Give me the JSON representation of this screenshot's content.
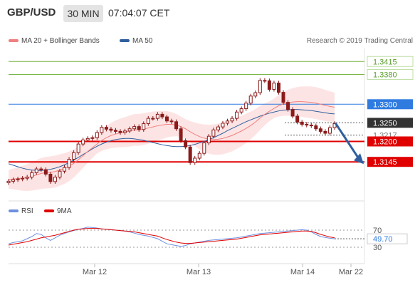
{
  "header": {
    "pair": "GBP/USD",
    "timeframe": "30 MIN",
    "time": "07:04:07 CET"
  },
  "legend": {
    "ma20_label": "MA 20 + Bollinger Bands",
    "ma50_label": "MA 50",
    "credit": "Research © 2019 Trading Central",
    "rsi_label": "RSI",
    "ma9_label": "9MA"
  },
  "colors": {
    "ma20": "#f08080",
    "ma50": "#2f5f9e",
    "bollinger_fill": "#fde4e4",
    "resistance_green": "#7ab648",
    "pivot_blue": "#2f7be0",
    "support_red": "#e00000",
    "rsi_line": "#6f8fe0",
    "rsi_ma": "#e00000",
    "candle": "#8b1a1a"
  },
  "chart_data": [
    {
      "type": "candlestick",
      "title": "GBP/USD",
      "timeframe": "30 MIN",
      "x_ticks": [
        "Mar 12",
        "Mar 13",
        "Mar 14",
        "Mar 22"
      ],
      "y_range": [
        1.304,
        1.345
      ],
      "levels": [
        {
          "value": "1.3415",
          "kind": "resistance",
          "color": "#7ab648"
        },
        {
          "value": "1.3380",
          "kind": "resistance",
          "color": "#7ab648"
        },
        {
          "value": "1.3300",
          "kind": "pivot",
          "color": "#2f7be0"
        },
        {
          "value": "1.3250",
          "kind": "last",
          "color": "#333333"
        },
        {
          "value": "1.3217",
          "kind": "reference",
          "color": "#777777"
        },
        {
          "value": "1.3200",
          "kind": "support",
          "color": "#e00000"
        },
        {
          "value": "1.3145",
          "kind": "support",
          "color": "#e00000"
        }
      ],
      "close": [
        1.3093,
        1.3097,
        1.3099,
        1.3101,
        1.3104,
        1.3116,
        1.3126,
        1.3124,
        1.3112,
        1.3092,
        1.3104,
        1.312,
        1.313,
        1.3152,
        1.317,
        1.3193,
        1.3204,
        1.3208,
        1.321,
        1.3224,
        1.3238,
        1.3233,
        1.323,
        1.3227,
        1.3224,
        1.3228,
        1.3234,
        1.324,
        1.3232,
        1.3248,
        1.3262,
        1.3262,
        1.3273,
        1.3266,
        1.3255,
        1.3253,
        1.3234,
        1.3202,
        1.3185,
        1.3143,
        1.3155,
        1.3168,
        1.3196,
        1.3214,
        1.3231,
        1.3239,
        1.3249,
        1.3255,
        1.3262,
        1.3279,
        1.3288,
        1.3303,
        1.3322,
        1.3331,
        1.3364,
        1.3363,
        1.334,
        1.3357,
        1.3332,
        1.3305,
        1.3286,
        1.3268,
        1.3252,
        1.3246,
        1.3244,
        1.3242,
        1.3234,
        1.3227,
        1.3222,
        1.3237,
        1.3248
      ],
      "ma20": [
        1.3098,
        1.3099,
        1.31,
        1.3101,
        1.3103,
        1.3106,
        1.311,
        1.3114,
        1.3116,
        1.3117,
        1.3119,
        1.3123,
        1.3127,
        1.3133,
        1.3141,
        1.3151,
        1.3162,
        1.3173,
        1.3183,
        1.3193,
        1.3203,
        1.321,
        1.3216,
        1.322,
        1.3223,
        1.3225,
        1.3228,
        1.3231,
        1.3231,
        1.3233,
        1.3236,
        1.3239,
        1.3242,
        1.3244,
        1.3246,
        1.3246,
        1.3244,
        1.324,
        1.3234,
        1.3226,
        1.3219,
        1.3213,
        1.3209,
        1.3206,
        1.3205,
        1.3206,
        1.3208,
        1.3212,
        1.3216,
        1.3222,
        1.3228,
        1.3235,
        1.3243,
        1.3252,
        1.3263,
        1.3273,
        1.3281,
        1.3289,
        1.3296,
        1.3301,
        1.3304,
        1.3306,
        1.3307,
        1.3307,
        1.3306,
        1.3305,
        1.3303,
        1.33,
        1.3297,
        1.3294,
        1.3292
      ],
      "ma50": [
        1.314,
        1.3136,
        1.3132,
        1.3128,
        1.3125,
        1.3123,
        1.3122,
        1.3122,
        1.3123,
        1.3125,
        1.3128,
        1.3132,
        1.3137,
        1.3143,
        1.315,
        1.3157,
        1.3165,
        1.3172,
        1.318,
        1.3187,
        1.3193,
        1.3198,
        1.3202,
        1.3205,
        1.3207,
        1.3208,
        1.3208,
        1.3207,
        1.3205,
        1.3203,
        1.32,
        1.3197,
        1.3194,
        1.3191,
        1.3189,
        1.3187,
        1.3186,
        1.3186,
        1.3187,
        1.3189,
        1.3192,
        1.3196,
        1.32,
        1.3205,
        1.321,
        1.3216,
        1.3222,
        1.3229,
        1.3235,
        1.3241,
        1.3247,
        1.3253,
        1.3258,
        1.3263,
        1.3268,
        1.3272,
        1.3276,
        1.3279,
        1.3282,
        1.3284,
        1.3285,
        1.3286,
        1.3286,
        1.3285,
        1.3284,
        1.3283,
        1.3281,
        1.3279,
        1.3277,
        1.3275,
        1.3274
      ],
      "forecast_arrow": {
        "from": 1.325,
        "to": 1.3145
      }
    },
    {
      "type": "line",
      "title": "RSI",
      "series": [
        {
          "name": "RSI",
          "values": [
            38,
            41,
            43,
            45,
            50,
            55,
            62,
            60,
            52,
            46,
            52,
            58,
            62,
            66,
            69,
            72,
            74,
            77,
            76,
            75,
            73,
            72,
            71,
            70,
            69,
            68,
            66,
            63,
            60,
            58,
            56,
            53,
            50,
            44,
            38,
            36,
            34,
            32,
            34,
            38,
            40,
            42,
            44,
            46,
            47,
            48,
            49,
            50,
            51,
            52,
            54,
            56,
            58,
            60,
            62,
            63,
            64,
            65,
            66,
            67,
            68,
            69,
            70,
            71,
            70,
            66,
            60,
            55,
            53,
            51,
            49.7
          ]
        },
        {
          "name": "9MA",
          "values": [
            35,
            37,
            39,
            41,
            43,
            46,
            49,
            52,
            54,
            56,
            58,
            61,
            64,
            67,
            70,
            72,
            73,
            74,
            74,
            74,
            73,
            72,
            71,
            70,
            69,
            68,
            67,
            66,
            64,
            62,
            60,
            58,
            56,
            52,
            48,
            45,
            42,
            40,
            39,
            39,
            40,
            41,
            42,
            43,
            44,
            45,
            46,
            47,
            48,
            49,
            51,
            53,
            55,
            57,
            59,
            60,
            61,
            62,
            63,
            64,
            65,
            66,
            67,
            68,
            68,
            67,
            64,
            60,
            57,
            54,
            52
          ]
        }
      ],
      "y_ticks": [
        "70",
        "30"
      ],
      "last_value": "49.70"
    }
  ]
}
